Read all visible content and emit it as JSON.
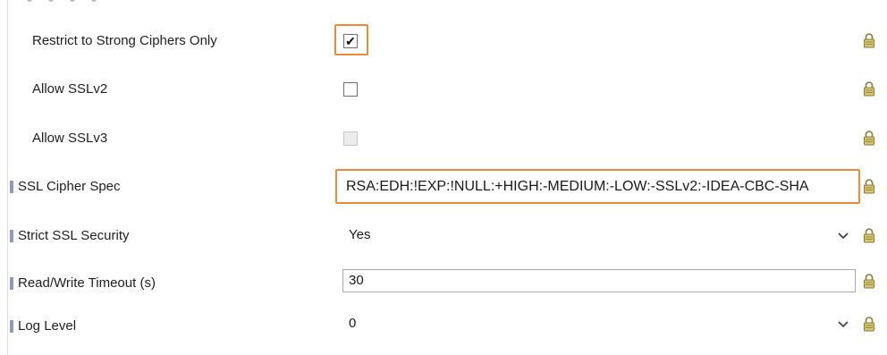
{
  "rows": [
    {
      "label": "Restrict to Strong Ciphers Only",
      "control": "checkbox",
      "checked": true,
      "highlighted": true
    },
    {
      "label": "Allow SSLv2",
      "control": "checkbox",
      "checked": false
    },
    {
      "label": "Allow SSLv3",
      "control": "checkbox",
      "checked": false,
      "disabled": true
    },
    {
      "label": "SSL Cipher Spec",
      "control": "text",
      "value": "RSA:EDH:!EXP:!NULL:+HIGH:-MEDIUM:-LOW:-SSLv2:-IDEA-CBC-SHA",
      "highlighted": true
    },
    {
      "label": "Strict SSL Security",
      "control": "select",
      "value": "Yes"
    },
    {
      "label": "Read/Write Timeout (s)",
      "control": "text",
      "value": "30"
    },
    {
      "label": "Log Level",
      "control": "select",
      "value": "0"
    }
  ],
  "checkmark": "✔",
  "colors": {
    "highlight": "#f0883a",
    "marker": "#8c98c8",
    "lock": "#b59a3a"
  },
  "icons": {
    "lock": "lock-icon",
    "dropdown": "chevron-down-icon"
  }
}
